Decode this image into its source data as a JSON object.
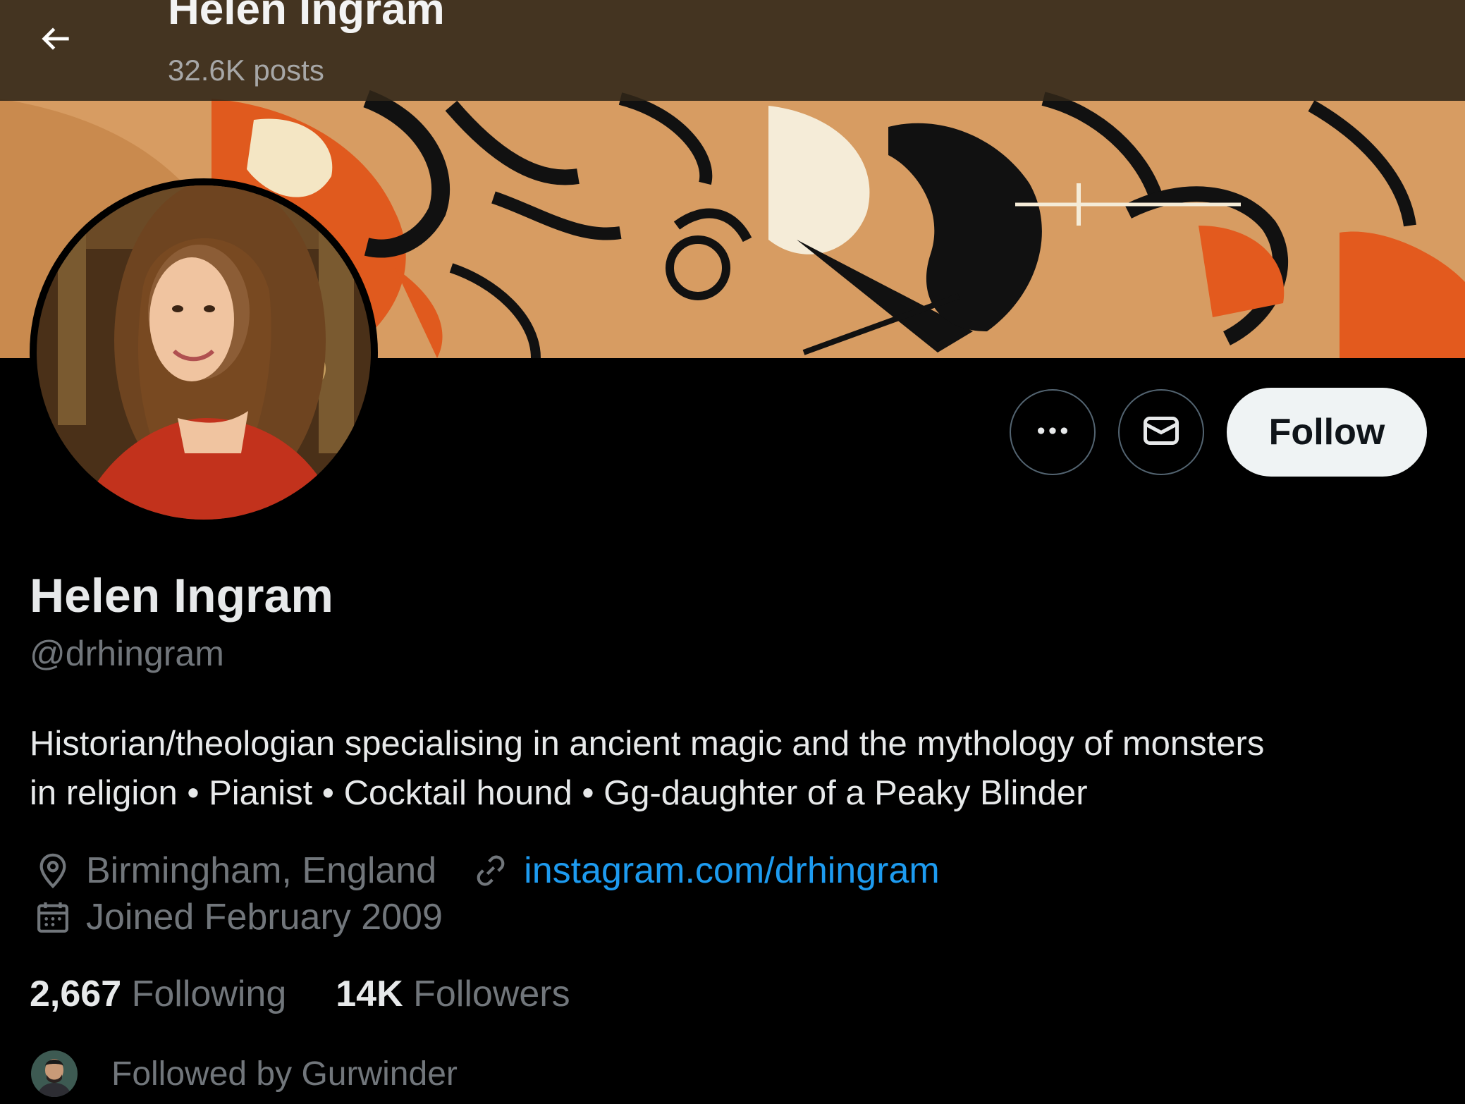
{
  "header": {
    "title": "Helen Ingram",
    "posts_count": "32.6K posts"
  },
  "profile": {
    "display_name": "Helen Ingram",
    "handle": "@drhingram",
    "bio_lines": [
      "Historian/theologian specialising in ancient magic and the mythology of monsters",
      "in religion • Pianist • Cocktail hound • Gg-daughter of a Peaky Blinder"
    ],
    "location": "Birmingham, England",
    "website": "instagram.com/drhingram",
    "joined": "Joined February 2009"
  },
  "stats": {
    "following_count": "2,667",
    "following_label": "Following",
    "followers_count": "14K",
    "followers_label": "Followers"
  },
  "followed_by": "Followed by Gurwinder",
  "actions": {
    "follow_label": "Follow"
  },
  "colors": {
    "background": "#000000",
    "link": "#1d9bf0",
    "muted": "#71767b",
    "follow_bg": "#eff3f4"
  },
  "icons": [
    "back-arrow-icon",
    "more-icon",
    "mail-icon",
    "location-icon",
    "link-icon",
    "calendar-icon"
  ]
}
